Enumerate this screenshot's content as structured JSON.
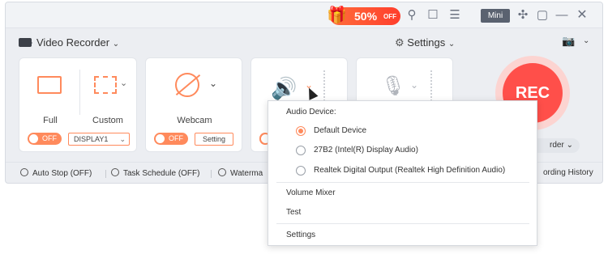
{
  "promo": {
    "percent": "50%",
    "off": "OFF"
  },
  "titlebar": {
    "mini_label": "Mini"
  },
  "recorder": {
    "title": "Video Recorder",
    "settings_label": "Settings",
    "full_label": "Full",
    "custom_label": "Custom",
    "webcam_label": "Webcam",
    "toggle_off": "OFF",
    "display_value": "DISPLAY1",
    "webcam_setting": "Setting"
  },
  "record": {
    "rec_label": "REC",
    "mode_label": "rder"
  },
  "bottombar": {
    "auto_stop": "Auto Stop (OFF)",
    "task_schedule": "Task Schedule (OFF)",
    "watermark": "Waterma",
    "history": "ording History"
  },
  "audio_menu": {
    "header": "Audio Device:",
    "devices": [
      {
        "label": "Default Device",
        "selected": true
      },
      {
        "label": "27B2 (Intel(R) Display Audio)",
        "selected": false
      },
      {
        "label": "Realtek Digital Output (Realtek High Definition Audio)",
        "selected": false
      }
    ],
    "volume_mixer": "Volume Mixer",
    "test": "Test",
    "settings": "Settings"
  },
  "colors": {
    "accent": "#ff8a5c",
    "rec": "#ff4f4a",
    "promo": "#ff4a2e"
  }
}
